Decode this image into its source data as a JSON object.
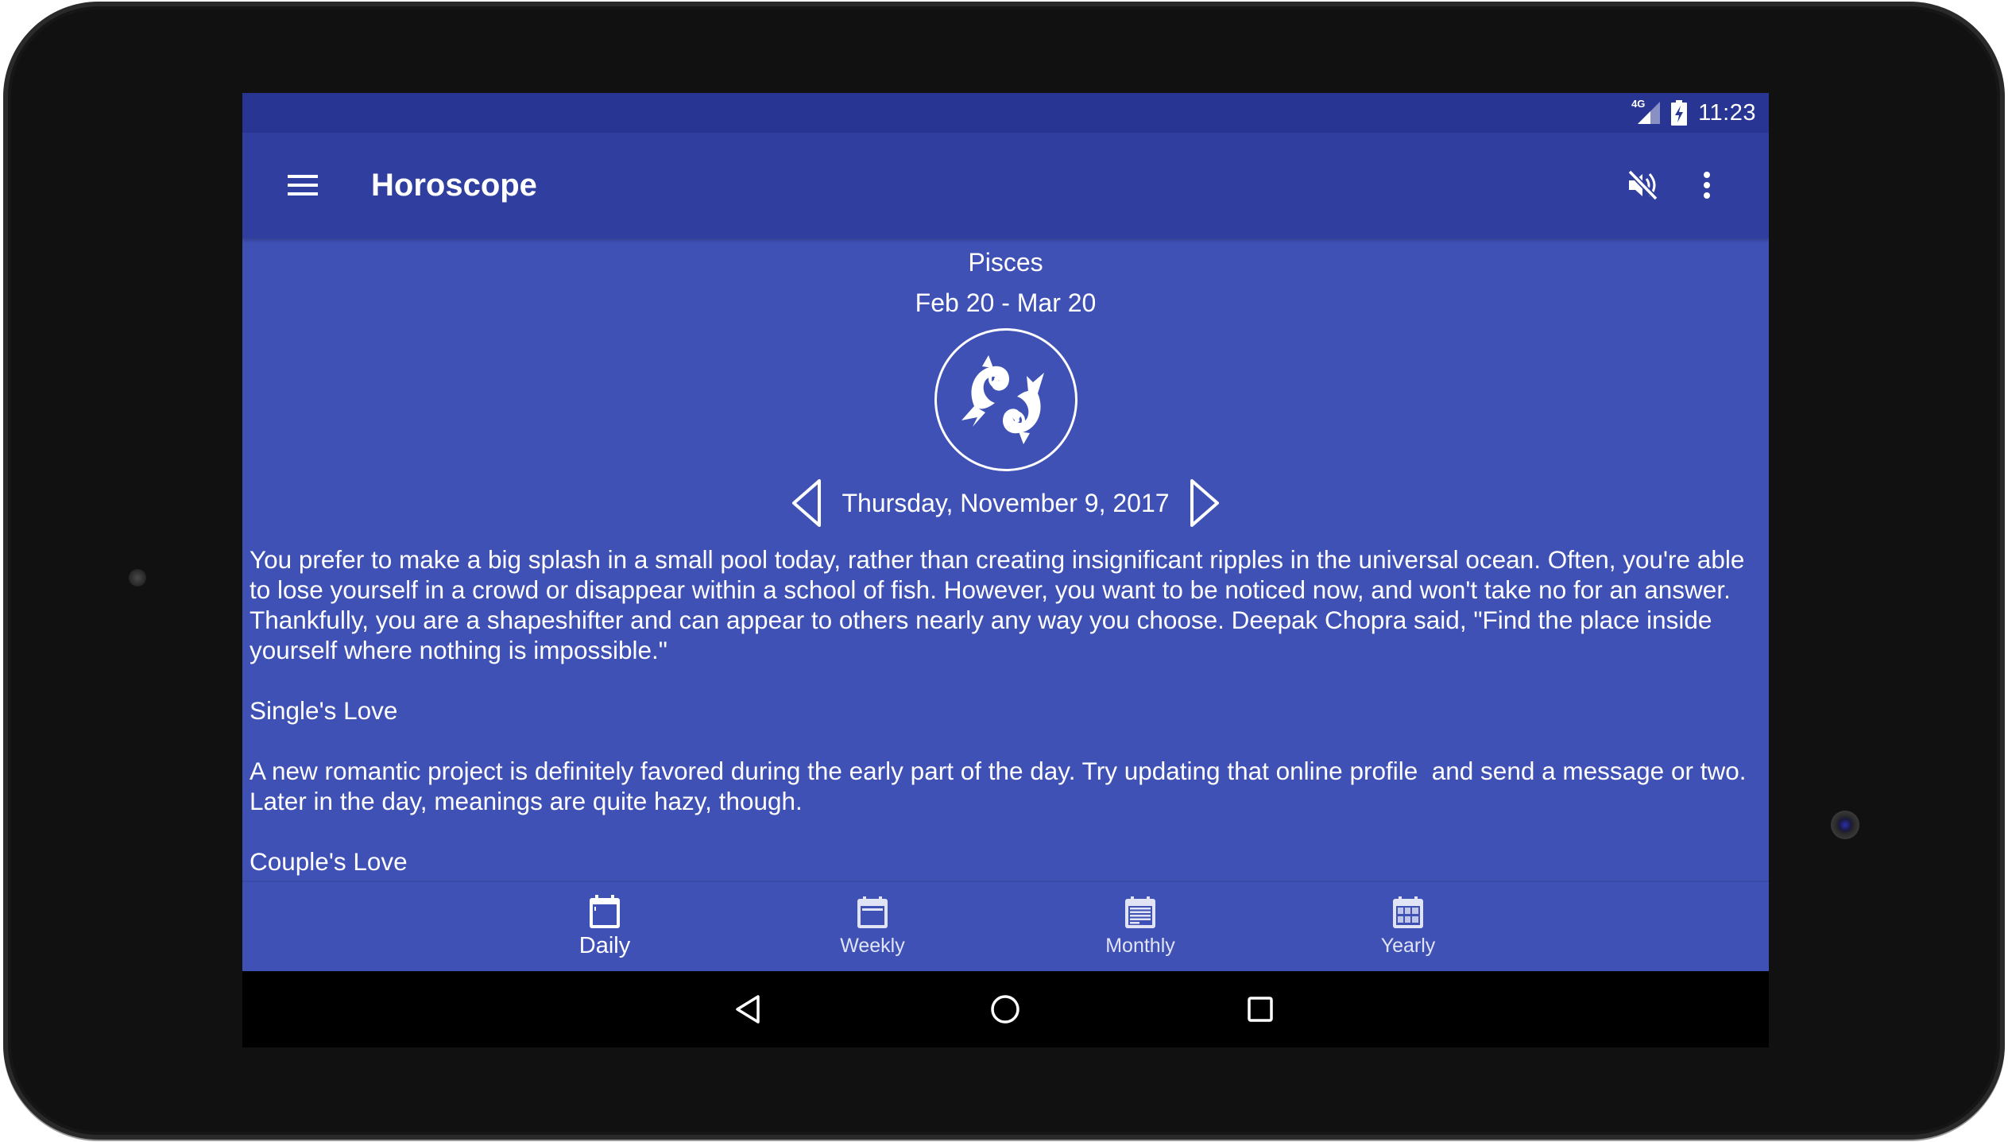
{
  "status_bar": {
    "network": "4G",
    "time": "11:23",
    "icons": [
      "signal-4g-icon",
      "battery-charging-icon"
    ]
  },
  "app_bar": {
    "title": "Horoscope",
    "menu_icon": "hamburger-menu-icon",
    "actions": [
      {
        "name": "sound-off",
        "icon": "volume-off-icon"
      },
      {
        "name": "more-options",
        "icon": "more-vert-icon"
      }
    ]
  },
  "sign": {
    "name": "Pisces",
    "dates": "Feb 20 - Mar 20",
    "image_icon": "pisces-fish-icon"
  },
  "date_nav": {
    "date": "Thursday, November 9, 2017",
    "prev_icon": "triangle-left-icon",
    "next_icon": "triangle-right-icon"
  },
  "reading": {
    "paragraphs": [
      "You prefer to make a big splash in a small pool today, rather than creating insignificant ripples in the universal ocean. Often, you're able to lose yourself in a crowd or disappear within a school of fish. However, you want to be noticed now, and won't take no for an answer. Thankfully, you are a shapeshifter and can appear to others nearly any way you choose. Deepak Chopra said, \"Find the place inside yourself where nothing is impossible.\"",
      "Single's Love",
      "A new romantic project is definitely favored during the early part of the day. Try updating that online profile  and send a message or two. Later in the day, meanings are quite hazy, though.",
      "Couple's Love"
    ]
  },
  "bottom_nav": {
    "active": "Daily",
    "tabs": [
      {
        "label": "Daily",
        "icon": "calendar-day-icon"
      },
      {
        "label": "Weekly",
        "icon": "calendar-week-icon"
      },
      {
        "label": "Monthly",
        "icon": "calendar-month-icon"
      },
      {
        "label": "Yearly",
        "icon": "calendar-year-icon"
      }
    ]
  },
  "system_nav": {
    "buttons": [
      "back",
      "home",
      "recents"
    ]
  },
  "colors": {
    "primary": "#3f51b5",
    "primary_dark": "#303f9f",
    "status_bar": "#283593",
    "text": "#ffffff"
  }
}
